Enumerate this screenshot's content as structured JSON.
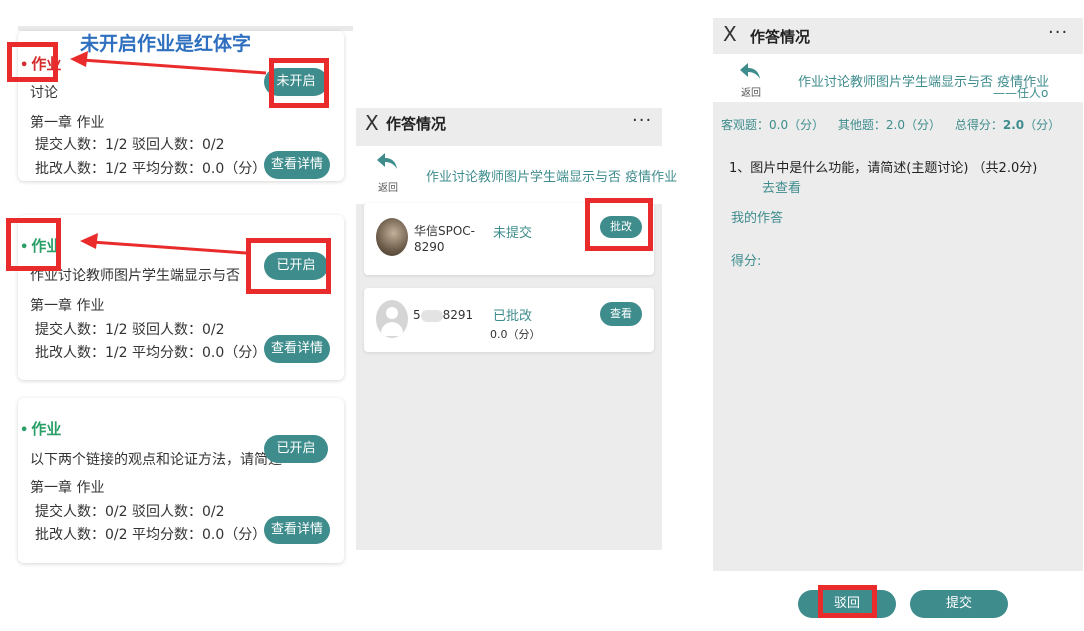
{
  "annotation": "未开启作业是红体字",
  "cards": [
    {
      "tag": "作业",
      "title": "讨论",
      "chapter": "第一章 作业",
      "stat1": "提交人数：1/2 驳回人数：0/2",
      "stat2": "批改人数：1/2 平均分数：0.0（分）",
      "status_label": "未开启",
      "detail_label": "查看详情"
    },
    {
      "tag": "作业",
      "title": "作业讨论教师图片学生端显示与否",
      "chapter": "第一章 作业",
      "stat1": "提交人数：1/2 驳回人数：0/2",
      "stat2": "批改人数：1/2 平均分数：0.0（分）",
      "status_label": "已开启",
      "detail_label": "查看详情"
    },
    {
      "tag": "作业",
      "title": "以下两个链接的观点和论证方法，请简述",
      "chapter": "第一章 作业",
      "stat1": "提交人数：0/2 驳回人数：0/2",
      "stat2": "批改人数：0/2 平均分数：0.0（分）",
      "status_label": "已开启",
      "detail_label": "查看详情"
    }
  ],
  "middle": {
    "close": "X",
    "title": "作答情况",
    "more": "···",
    "back": "返回",
    "subtitle": "作业讨论教师图片学生端显示与否 疫情作业",
    "students": [
      {
        "name1": "华信SPOC-",
        "name2": "8290",
        "status": "未提交",
        "score": "",
        "action": "批改"
      },
      {
        "name1": "5",
        "name2": "8291",
        "status": "已批改",
        "score": "0.0（分）",
        "action": "查看"
      }
    ]
  },
  "right": {
    "close": "X",
    "title": "作答情况",
    "more": "···",
    "back": "返回",
    "subtitle": "作业讨论教师图片学生端显示与否 疫情作业",
    "subtitle2": "——任人o",
    "objective": "客观题：0.0（分）",
    "other": "其他题：2.0（分）",
    "total_label": "总得分：",
    "total_value": "2.0",
    "total_unit": "（分）",
    "question": "1、图片中是什么功能，请简述(主题讨论) （共2.0分)",
    "go_view": "去查看",
    "my_answer": "我的作答",
    "score_label": "得分:",
    "reject": "驳回",
    "submit": "提交"
  },
  "colors": {
    "accent": "#3f8c8d",
    "red": "#d62b2b",
    "green": "#2a9f67",
    "annotation": "#2f6fbf",
    "highlight": "#ea2b2b"
  }
}
